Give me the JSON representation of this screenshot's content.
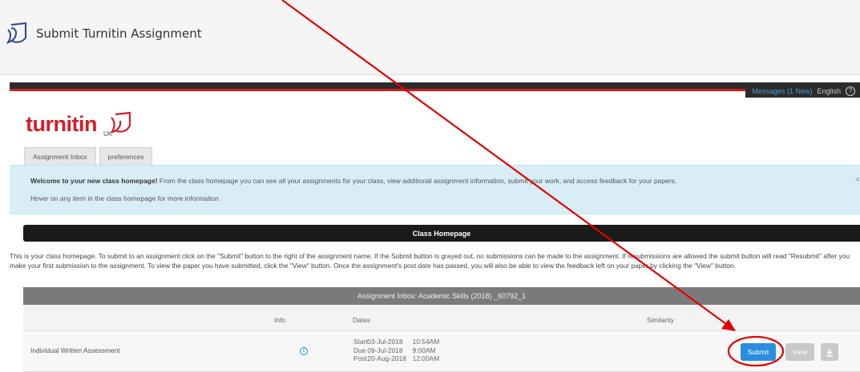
{
  "header": {
    "title": "Submit Turnitin Assignment",
    "icon": "turnitin-feather-icon"
  },
  "utility_bar": {
    "messages": "Messages (1 New)",
    "language": "English",
    "help_icon": "help-circle-icon"
  },
  "logo": {
    "word": "turnitin",
    "region": "UK"
  },
  "tabs": [
    {
      "label": "Assignment Inbox"
    },
    {
      "label": "preferences"
    }
  ],
  "welcome": {
    "bold": "Welcome to your new class homepage!",
    "text": " From the class homepage you can see all your assignments for your class, view additional assignment information, submit your work, and access feedback for your papers.",
    "hover": "Hover on any item in the class homepage for more information.",
    "close": "×"
  },
  "section_title": "Class Homepage",
  "intro": "This is your class homepage. To submit to an assignment click on the \"Submit\" button to the right of the assignment name. If the Submit button is grayed out, no submissions can be made to the assignment. If resubmissions are allowed the submit button will read \"Resubmit\" after you make your first submission to the assignment. To view the paper you have submitted, click the \"View\" button. Once the assignment's post date has passed, you will also be able to view the feedback left on your paper by clicking the \"View\" button.",
  "inbox": {
    "title": "Assignment Inbox: Academic Skills (2018) _60792_1",
    "columns": {
      "info": "Info",
      "dates": "Dates",
      "similarity": "Similarity"
    },
    "rows": [
      {
        "name": "Individual Written Assessment",
        "info_icon": "info-icon",
        "dates": [
          {
            "label": "Start",
            "date": "03-Jul-2018",
            "time": "10:54AM"
          },
          {
            "label": "Due",
            "date": "09-Jul-2018",
            "time": "9:00AM"
          },
          {
            "label": "Post",
            "date": "20-Aug-2018",
            "time": "12:00AM"
          }
        ],
        "submit_label": "Submit",
        "view_label": "View",
        "download_icon": "download-icon"
      }
    ]
  },
  "annotation": {
    "arrow_color": "#e00000",
    "circle_color": "#e00000"
  },
  "colors": {
    "brand_red": "#d11f2a",
    "submit_blue": "#2a8ee0",
    "welcome_bg": "#d9edf7"
  }
}
